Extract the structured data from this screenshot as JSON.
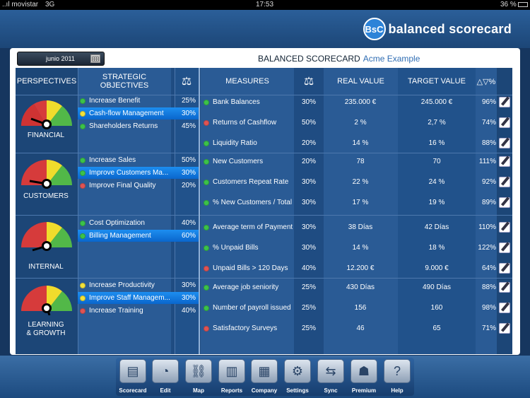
{
  "status": {
    "carrier": "..ıl movistar",
    "network": "3G",
    "time": "17:53",
    "battery": "36 %"
  },
  "brand": {
    "badge": "BsC",
    "name": "balanced scorecard"
  },
  "date": "junio 2011",
  "title": {
    "main": "BALANCED SCORECARD",
    "sub": "Acme Example"
  },
  "headers": {
    "perspectives": "PERSPECTIVES",
    "objectives": "STRATEGIC OBJECTIVES",
    "measures": "MEASURES",
    "real": "REAL VALUE",
    "target": "TARGET VALUE",
    "delta": "△▽%"
  },
  "colors": {
    "green": "#3cc24a",
    "yellow": "#f2e23a",
    "red": "#e05454",
    "selected": "#1d8ef0"
  },
  "perspectives": [
    {
      "label": "FINANCIAL",
      "needle": "left-mid"
    },
    {
      "label": "CUSTOMERS",
      "needle": "left-mid"
    },
    {
      "label": "INTERNAL",
      "needle": "left-low"
    },
    {
      "label": "LEARNING & GROWTH",
      "needle": "down"
    }
  ],
  "objectives": [
    {
      "label": "Increase Benefit",
      "weight": "25%",
      "status": "green",
      "selected": false
    },
    {
      "label": "Cash-flow Management",
      "weight": "30%",
      "status": "yellow",
      "selected": true
    },
    {
      "label": "Shareholders Returns",
      "weight": "45%",
      "status": "green",
      "selected": false
    },
    {
      "label": "Increase Sales",
      "weight": "50%",
      "status": "green",
      "selected": false
    },
    {
      "label": "Improve Customers Ma...",
      "weight": "30%",
      "status": "green",
      "selected": true
    },
    {
      "label": "Improve Final Quality",
      "weight": "20%",
      "status": "red",
      "selected": false
    },
    {
      "label": "Cost Optimization",
      "weight": "40%",
      "status": "green",
      "selected": false
    },
    {
      "label": "Billing Management",
      "weight": "60%",
      "status": "green",
      "selected": true
    },
    {
      "label": "Increase Productivity",
      "weight": "30%",
      "status": "yellow",
      "selected": false
    },
    {
      "label": "Improve Staff Managem...",
      "weight": "30%",
      "status": "yellow",
      "selected": true
    },
    {
      "label": "Increase Training",
      "weight": "40%",
      "status": "red",
      "selected": false
    }
  ],
  "measures": [
    {
      "name": "Bank Balances",
      "weight": "30%",
      "real": "235.000 €",
      "target": "245.000 €",
      "pct": "96%",
      "status": "green"
    },
    {
      "name": "Returns of Cashflow",
      "weight": "50%",
      "real": "2 %",
      "target": "2,7 %",
      "pct": "74%",
      "status": "red"
    },
    {
      "name": "Liquidity Ratio",
      "weight": "20%",
      "real": "14 %",
      "target": "16 %",
      "pct": "88%",
      "status": "green"
    },
    {
      "name": "New Customers",
      "weight": "20%",
      "real": "78",
      "target": "70",
      "pct": "111%",
      "status": "green"
    },
    {
      "name": "Customers Repeat Rate",
      "weight": "30%",
      "real": "22 %",
      "target": "24 %",
      "pct": "92%",
      "status": "green"
    },
    {
      "name": "% New Customers / Total",
      "weight": "30%",
      "real": "17 %",
      "target": "19 %",
      "pct": "89%",
      "status": "green"
    },
    {
      "name": "Average term of Payment",
      "weight": "30%",
      "real": "38 Días",
      "target": "42 Días",
      "pct": "110%",
      "status": "green"
    },
    {
      "name": "% Unpaid Bills",
      "weight": "30%",
      "real": "14 %",
      "target": "18 %",
      "pct": "122%",
      "status": "green"
    },
    {
      "name": "Unpaid Bills > 120 Days",
      "weight": "40%",
      "real": "12.200 €",
      "target": "9.000 €",
      "pct": "64%",
      "status": "red"
    },
    {
      "name": "Average job seniority",
      "weight": "25%",
      "real": "430 Días",
      "target": "490 Días",
      "pct": "88%",
      "status": "green"
    },
    {
      "name": "Number of payroll issued",
      "weight": "25%",
      "real": "156",
      "target": "160",
      "pct": "98%",
      "status": "green"
    },
    {
      "name": "Satisfactory Surveys",
      "weight": "25%",
      "real": "46",
      "target": "65",
      "pct": "71%",
      "status": "red"
    }
  ],
  "toolbar": [
    {
      "label": "Scorecard",
      "icon": "scorecard-icon",
      "glyph": "▤"
    },
    {
      "label": "Edit",
      "icon": "gauge-icon",
      "glyph": "◔"
    },
    {
      "label": "Map",
      "icon": "map-icon",
      "glyph": "⛓"
    },
    {
      "label": "Reports",
      "icon": "bar-chart-icon",
      "glyph": "▥"
    },
    {
      "label": "Company",
      "icon": "building-icon",
      "glyph": "▦"
    },
    {
      "label": "Settings",
      "icon": "gear-icon",
      "glyph": "⚙"
    },
    {
      "label": "Sync",
      "icon": "sync-icon",
      "glyph": "⇆"
    },
    {
      "label": "Premium",
      "icon": "user-icon",
      "glyph": "☗"
    },
    {
      "label": "Help",
      "icon": "help-icon",
      "glyph": "?"
    }
  ]
}
